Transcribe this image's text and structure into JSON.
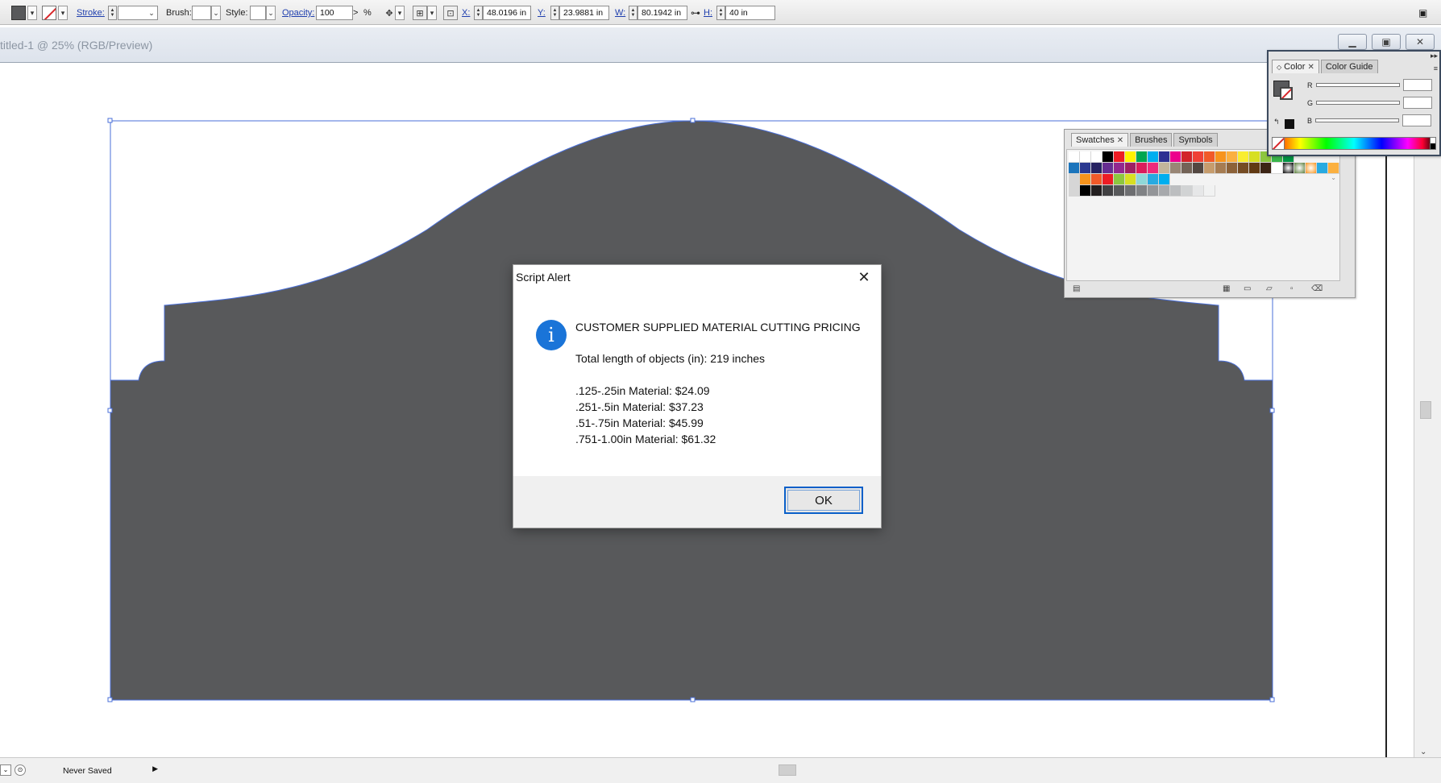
{
  "toolbar": {
    "stroke_label": "Stroke:",
    "brush_label": "Brush:",
    "style_label": "Style:",
    "opacity_label": "Opacity:",
    "opacity_value": "100",
    "opacity_arrow": ">",
    "percent": "%",
    "x_label": "X:",
    "x_value": "48.0196 in",
    "y_label": "Y:",
    "y_value": "23.9881 in",
    "w_label": "W:",
    "w_value": "80.1942 in",
    "h_label": "H:",
    "h_value": "40 in",
    "fill_color": "#58595b"
  },
  "document": {
    "title": "titled-1 @ 25% (RGB/Preview)",
    "shape_color": "#58595b",
    "selection_color": "#4a6fd8"
  },
  "status": {
    "save_state": "Never Saved"
  },
  "swatches_panel": {
    "tabs": [
      "Swatches",
      "Brushes",
      "Symbols"
    ]
  },
  "color_panel": {
    "tabs": [
      "Color",
      "Color Guide"
    ],
    "channels": [
      "R",
      "G",
      "B"
    ]
  },
  "dialog": {
    "title": "Script Alert",
    "info_glyph": "i",
    "heading": "CUSTOMER SUPPLIED MATERIAL CUTTING PRICING",
    "total": "Total length of objects (in): 219 inches",
    "prices": [
      ".125-.25in Material: $24.09",
      ".251-.5in Material: $37.23",
      ".51-.75in Material: $45.99",
      ".751-1.00in Material: $61.32"
    ],
    "ok_label": "OK"
  }
}
